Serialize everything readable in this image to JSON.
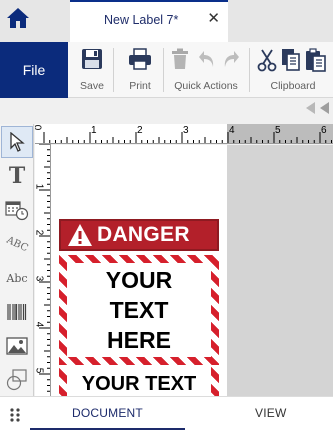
{
  "tab": {
    "title": "New Label 7*",
    "close_glyph": "✕"
  },
  "ribbon": {
    "file_label": "File",
    "save_label": "Save",
    "print_label": "Print",
    "quick_actions_label": "Quick Actions",
    "clipboard_label": "Clipboard"
  },
  "tools": [
    "select-tool",
    "text-tool",
    "date-time-tool",
    "curved-text-tool",
    "sequence-text-tool",
    "barcode-tool",
    "image-tool",
    "shape-tool"
  ],
  "tool_labels": {
    "text": "T",
    "curved": "ABC",
    "sequence": "Abc"
  },
  "rulers": {
    "horizontal_numbers": [
      "0",
      "1",
      "2",
      "3",
      "4",
      "5",
      "6"
    ],
    "vertical_numbers": [
      "0",
      "1",
      "2",
      "3",
      "4",
      "5"
    ]
  },
  "label": {
    "danger_text": "DANGER",
    "body_line1": "YOUR",
    "body_line2": "TEXT",
    "body_line3": "HERE",
    "second_text": "YOUR TEXT"
  },
  "bottom_tabs": {
    "document": "DOCUMENT",
    "view": "VIEW"
  },
  "colors": {
    "accent": "#0b2b7c",
    "danger_red": "#b3202a",
    "hazard_red": "#d6202c"
  }
}
